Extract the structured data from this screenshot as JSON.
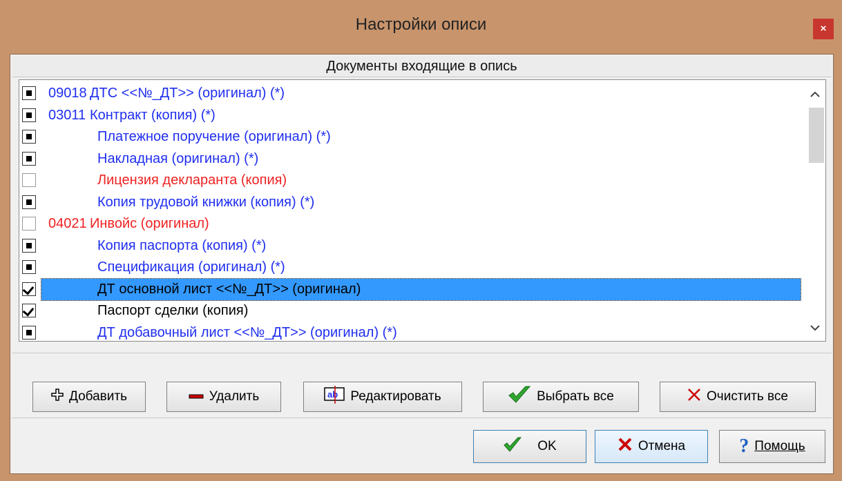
{
  "window": {
    "title": "Настройки описи",
    "close": "×"
  },
  "list": {
    "header": "Документы входящие в опись",
    "rows": [
      {
        "check": "partial",
        "code": "09018",
        "text": "ДТС <<№_ДТ>> (оригинал) (*)",
        "color": "blue",
        "indent": "top"
      },
      {
        "check": "partial",
        "code": "03011",
        "text": "Контракт (копия) (*)",
        "color": "blue",
        "indent": "top"
      },
      {
        "check": "partial",
        "code": "",
        "text": "Платежное поручение (оригинал) (*)",
        "color": "blue",
        "indent": "sub"
      },
      {
        "check": "partial",
        "code": "",
        "text": "Накладная (оригинал) (*)",
        "color": "blue",
        "indent": "sub"
      },
      {
        "check": "unchecked",
        "code": "",
        "text": "Лицензия декларанта (копия)",
        "color": "red",
        "indent": "sub"
      },
      {
        "check": "partial",
        "code": "",
        "text": "Копия трудовой книжки (копия) (*)",
        "color": "blue",
        "indent": "sub"
      },
      {
        "check": "unchecked",
        "code": "04021",
        "text": "Инвойс (оригинал)",
        "color": "red",
        "indent": "top"
      },
      {
        "check": "partial",
        "code": "",
        "text": "Копия паспорта (копия) (*)",
        "color": "blue",
        "indent": "sub"
      },
      {
        "check": "partial",
        "code": "",
        "text": "Спецификация (оригинал) (*)",
        "color": "blue",
        "indent": "sub"
      },
      {
        "check": "checked",
        "code": "",
        "text": "ДТ основной лист <<№_ДТ>> (оригинал)",
        "color": "black",
        "indent": "sub",
        "selected": true
      },
      {
        "check": "checked",
        "code": "",
        "text": "Паспорт сделки (копия)",
        "color": "black",
        "indent": "sub"
      },
      {
        "check": "partial",
        "code": "",
        "text": "ДТ добавочный лист <<№_ДТ>> (оригинал) (*)",
        "color": "blue",
        "indent": "sub"
      }
    ],
    "scroll_up": "^",
    "scroll_down": "v"
  },
  "buttons": {
    "add": "Добавить",
    "delete": "Удалить",
    "edit": "Редактировать",
    "edit_icon": "ab",
    "select_all": "Выбрать все",
    "clear_all": "Очистить все",
    "ok": "OK",
    "cancel": "Отмена",
    "help": "Помощь"
  },
  "icons": {
    "add": "plus-icon",
    "delete": "minus-icon",
    "edit": "text-edit-icon",
    "select_all": "checkmark-icon",
    "clear_all": "cross-icon",
    "ok": "checkmark-icon",
    "cancel": "cross-icon",
    "help": "question-icon"
  },
  "colors": {
    "blue": "#1f2ef0",
    "red": "#ef2222",
    "selection": "#3399ff",
    "titlebar": "#c8946c",
    "close": "#c7372f"
  }
}
